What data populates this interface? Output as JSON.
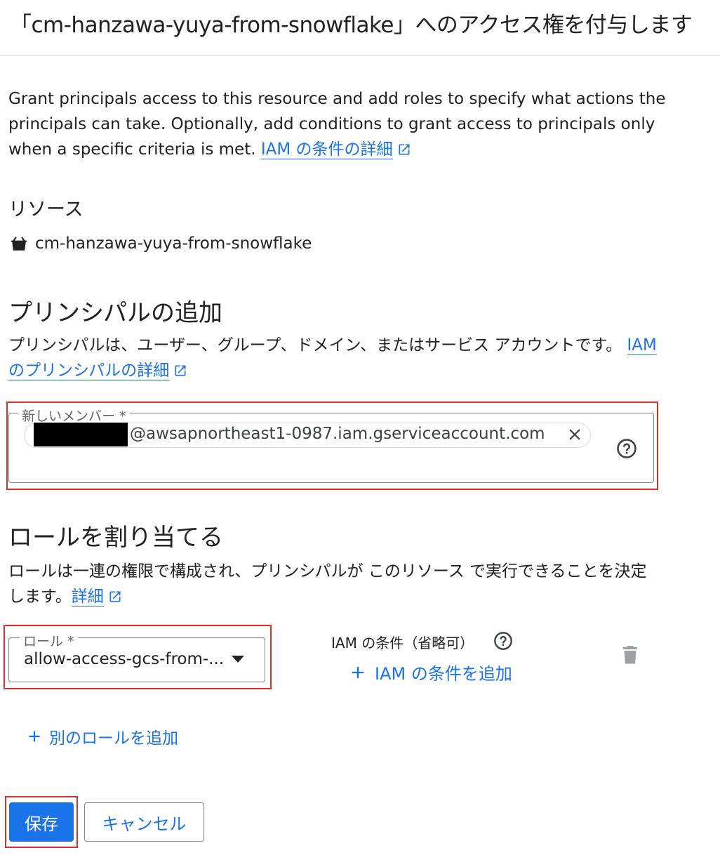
{
  "dialog": {
    "title": "「cm-hanzawa-yuya-from-snowflake」へのアクセス権を付与します"
  },
  "intro": {
    "text": "Grant principals access to this resource and add roles to specify what actions the principals can take. Optionally, add conditions to grant access to principals only when a specific criteria is met. ",
    "link": "IAM の条件の詳細"
  },
  "resource": {
    "label": "リソース",
    "icon": "bucket-icon",
    "name": "cm-hanzawa-yuya-from-snowflake"
  },
  "principals": {
    "heading": "プリンシパルの追加",
    "description": "プリンシパルは、ユーザー、グループ、ドメイン、またはサービス アカウントです。 ",
    "link": "IAM のプリンシパルの詳細",
    "field_label": "新しいメンバー *",
    "chip_value": "@awsapnortheast1-0987.iam.gserviceaccount.com"
  },
  "roles": {
    "heading": "ロールを割り当てる",
    "description": "ロールは一連の権限で構成され、プリンシパルが このリソース で実行できることを決定します。",
    "link": "詳細",
    "role_label": "ロール *",
    "role_value": "allow-access-gcs-from-...",
    "condition_label": "IAM の条件（省略可）",
    "add_condition": "IAM の条件を追加",
    "add_another_role": "別のロールを追加"
  },
  "actions": {
    "save": "保存",
    "cancel": "キャンセル"
  },
  "colors": {
    "accent": "#1a73e8",
    "highlight": "#d93025"
  }
}
